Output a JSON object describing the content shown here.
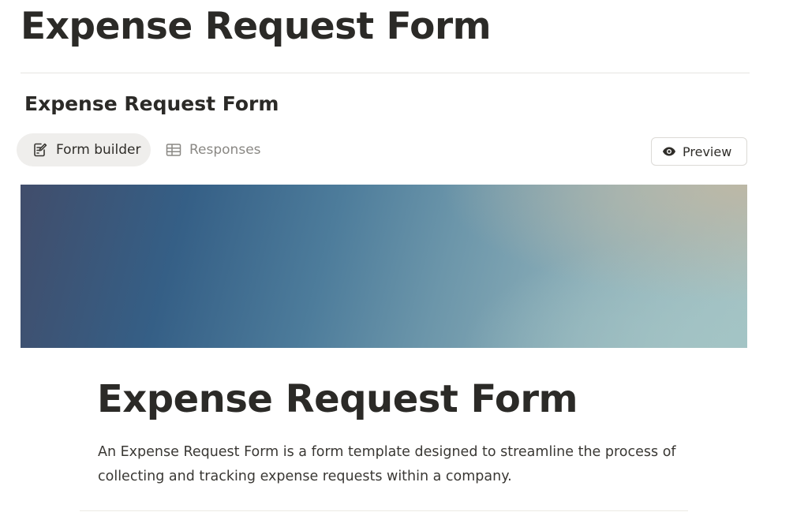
{
  "page": {
    "title": "Expense Request Form"
  },
  "form_header": {
    "title": "Expense Request Form"
  },
  "tabs": [
    {
      "label": "Form builder",
      "icon": "edit-form-icon",
      "active": true
    },
    {
      "label": "Responses",
      "icon": "table-icon",
      "active": false
    }
  ],
  "toolbar": {
    "preview_label": "Preview",
    "preview_icon": "eye-icon"
  },
  "cover": {
    "colors": [
      "#414d6b",
      "#355f86",
      "#6c96aa",
      "#bdb6a4",
      "#a6c3c4"
    ]
  },
  "form": {
    "title": "Expense Request Form",
    "description": "An Expense Request Form is a form template designed to streamline the process of collecting and tracking expense requests within a company."
  }
}
